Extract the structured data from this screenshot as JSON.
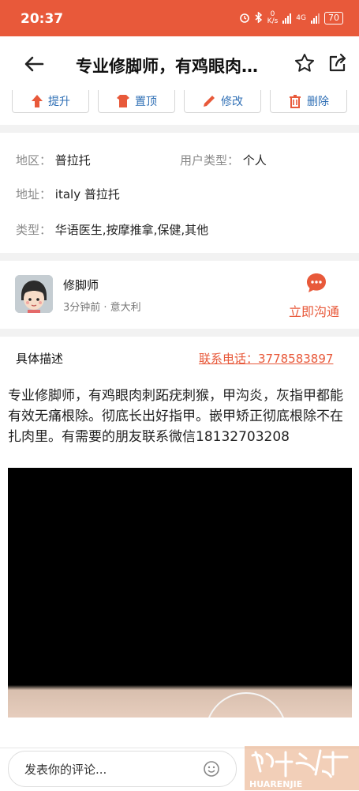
{
  "status": {
    "time": "20:37",
    "net_speed_value": "0",
    "net_speed_unit": "K/s",
    "net_label": "4G",
    "battery": "70"
  },
  "header": {
    "title": "专业修脚师，有鸡眼肉刺跖疣刺猴，甲沟炎，灰指甲都能有效无痛根除。"
  },
  "actions": [
    {
      "label": "提升"
    },
    {
      "label": "置顶"
    },
    {
      "label": "修改"
    },
    {
      "label": "删除"
    }
  ],
  "info": {
    "region_label": "地区：",
    "region_value": "普拉托",
    "usertype_label": "用户类型：",
    "usertype_value": "个人",
    "address_label": "地址：",
    "address_value": "italy 普拉托",
    "category_label": "类型：",
    "category_value": "华语医生,按摩推拿,保健,其他"
  },
  "poster": {
    "name": "修脚师",
    "meta": "3分钟前 · 意大利",
    "chat_label": "立即沟通"
  },
  "description": {
    "heading": "具体描述",
    "phone": "联系电话：3778583897",
    "text": "专业修脚师，有鸡眼肉刺跖疣刺猴，甲沟炎，灰指甲都能有效无痛根除。彻底长出好指甲。嵌甲矫正彻底根除不在扎肉里。有需要的朋友联系微信18132703208"
  },
  "comment": {
    "placeholder": "发表你的评论..."
  },
  "watermark": {
    "text": "HUARENJIE"
  },
  "colors": {
    "accent": "#e8593a",
    "action_blue": "#2f6fb5",
    "action_red": "#e8593a"
  }
}
